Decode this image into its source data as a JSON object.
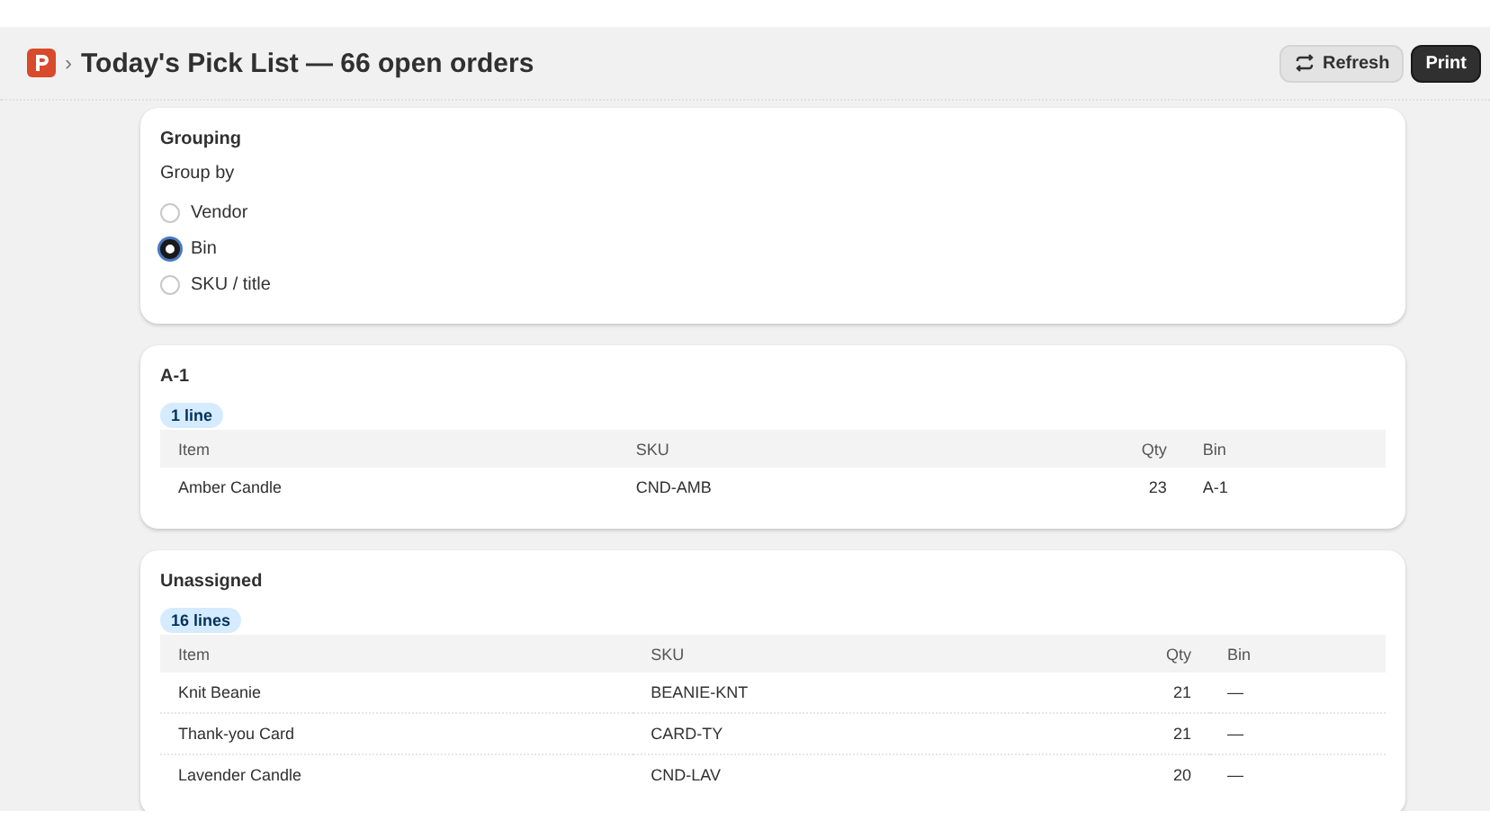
{
  "header": {
    "breadcrumb_separator": "›",
    "title": "Today's Pick List — 66 open orders",
    "buttons": [
      {
        "label": "Refresh",
        "kind": "secondary"
      },
      {
        "label": "Print",
        "kind": "primary"
      }
    ]
  },
  "grouping": {
    "title": "Grouping",
    "label": "Group by",
    "options": [
      {
        "label": "Vendor",
        "selected": false
      },
      {
        "label": "Bin",
        "selected": true
      },
      {
        "label": "SKU / title",
        "selected": false
      }
    ]
  },
  "groups": [
    {
      "title": "A-1",
      "badge": "1 line",
      "columns": [
        "Item",
        "SKU",
        "Qty",
        "Bin"
      ],
      "rows": [
        [
          "Amber Candle",
          "CND-AMB",
          "23",
          "A-1"
        ]
      ]
    },
    {
      "title": "Unassigned",
      "badge": "16 lines",
      "columns": [
        "Item",
        "SKU",
        "Qty",
        "Bin"
      ],
      "rows": [
        [
          "Knit Beanie",
          "BEANIE-KNT",
          "21",
          "—"
        ],
        [
          "Thank-you Card",
          "CARD-TY",
          "21",
          "—"
        ],
        [
          "Lavender Candle",
          "CND-LAV",
          "20",
          "—"
        ]
      ]
    }
  ]
}
